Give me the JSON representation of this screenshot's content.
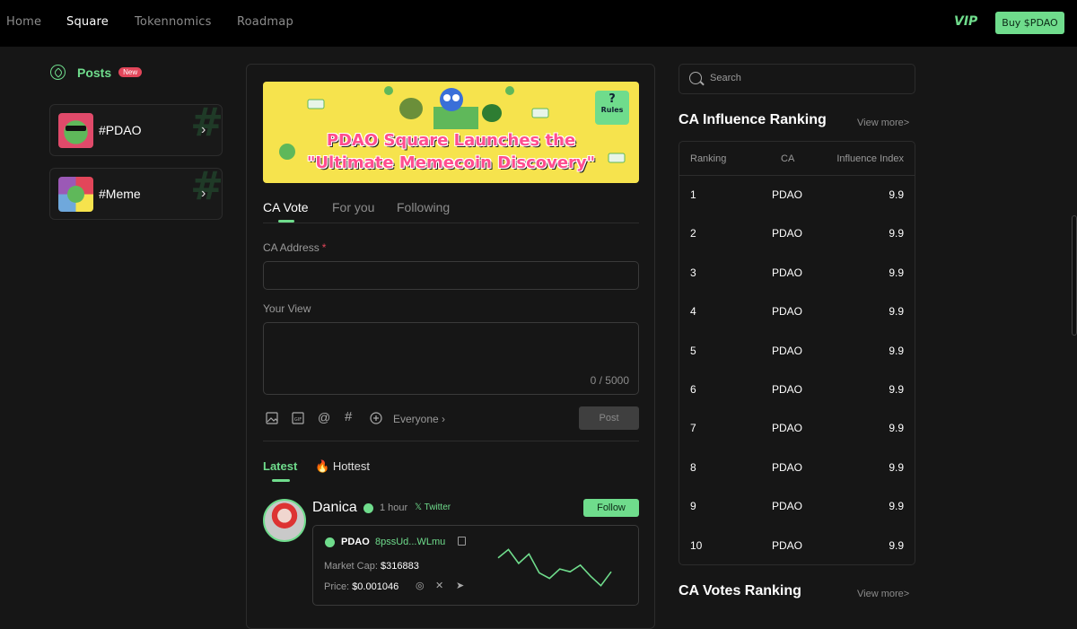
{
  "nav": {
    "links": [
      "Home",
      "Square",
      "Tokennomics",
      "Roadmap"
    ],
    "vip": "VIP",
    "buy": "Buy $PDAO"
  },
  "sidebar": {
    "posts_label": "Posts",
    "new_badge": "New",
    "topics": [
      {
        "label": "#PDAO",
        "icon": "pepe-avatar-icon"
      },
      {
        "label": "#Meme",
        "icon": "meme-collage-icon"
      }
    ]
  },
  "banner": {
    "line1": "PDAO Square Launches the",
    "line2": "\"Ultimate Memecoin Discovery\"",
    "rules": "Rules",
    "rules_q": "?"
  },
  "tabs": [
    "CA Vote",
    "For you",
    "Following"
  ],
  "form": {
    "ca_label": "CA Address",
    "required": "*",
    "view_label": "Your View",
    "counter": "0 / 5000",
    "audience": "Everyone",
    "post": "Post",
    "tools": [
      "image-icon",
      "gif-icon",
      "mention-icon",
      "hashtag-icon",
      "add-circle-icon"
    ]
  },
  "feed_tabs": {
    "latest": "Latest",
    "hottest": "Hottest"
  },
  "post": {
    "user": "Danica",
    "time": "1 hour",
    "source": "Twitter",
    "follow": "Follow",
    "token": "PDAO",
    "address": "8pssUd...WLmu",
    "market_cap_label": "Market Cap:",
    "market_cap": "$316883",
    "price_label": "Price:",
    "price": "$0.001046",
    "sparkline": [
      35,
      20,
      45,
      28,
      62,
      72,
      55,
      60,
      48,
      68,
      85,
      60
    ]
  },
  "search": {
    "placeholder": "Search"
  },
  "influence": {
    "title": "CA Influence Ranking",
    "view_more": "View more>",
    "headers": [
      "Ranking",
      "CA",
      "Influence Index"
    ],
    "rows": [
      [
        "1",
        "PDAO",
        "9.9"
      ],
      [
        "2",
        "PDAO",
        "9.9"
      ],
      [
        "3",
        "PDAO",
        "9.9"
      ],
      [
        "4",
        "PDAO",
        "9.9"
      ],
      [
        "5",
        "PDAO",
        "9.9"
      ],
      [
        "6",
        "PDAO",
        "9.9"
      ],
      [
        "7",
        "PDAO",
        "9.9"
      ],
      [
        "8",
        "PDAO",
        "9.9"
      ],
      [
        "9",
        "PDAO",
        "9.9"
      ],
      [
        "10",
        "PDAO",
        "9.9"
      ]
    ]
  },
  "votes": {
    "title": "CA Votes Ranking",
    "view_more": "View more>"
  },
  "colors": {
    "accent": "#6fdc8c",
    "bg": "#161616",
    "badge": "#e2465a",
    "banner": "#f6e34d"
  }
}
